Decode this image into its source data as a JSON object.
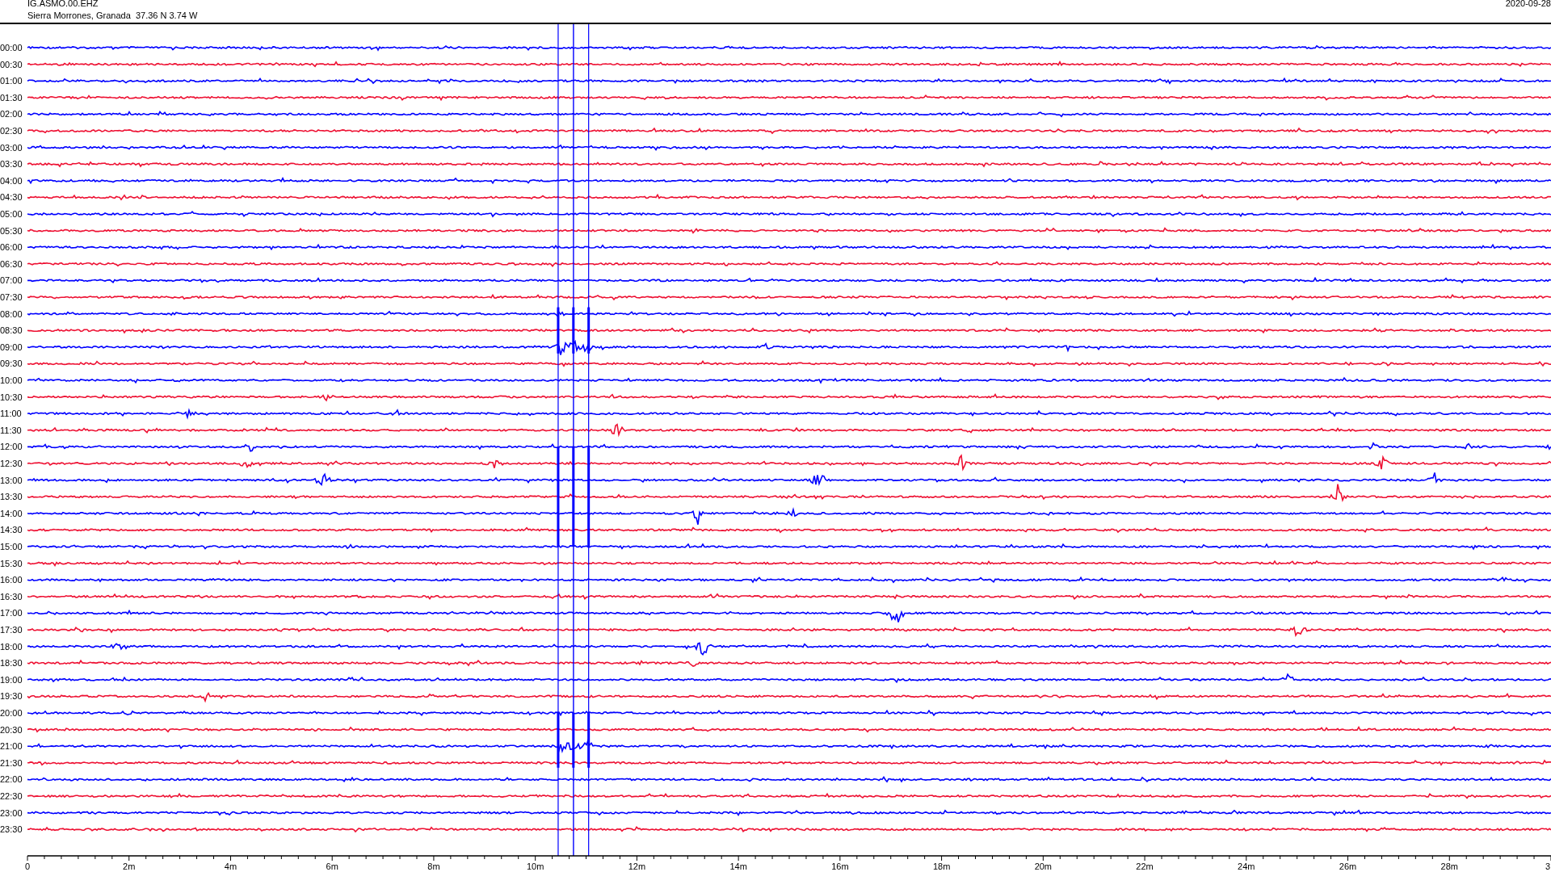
{
  "header": {
    "station": "IG.ASMO.00.EHZ",
    "location": "Sierra Morrones, Granada  37.36 N 3.74 W",
    "date": "2020-09-28"
  },
  "rows": [
    {
      "time": "00:00",
      "color": "#0000ff"
    },
    {
      "time": "00:30",
      "color": "#ee1133"
    },
    {
      "time": "01:00",
      "color": "#0000ff"
    },
    {
      "time": "01:30",
      "color": "#ee1133"
    },
    {
      "time": "02:00",
      "color": "#0000ff"
    },
    {
      "time": "02:30",
      "color": "#ee1133"
    },
    {
      "time": "03:00",
      "color": "#0000ff"
    },
    {
      "time": "03:30",
      "color": "#ee1133"
    },
    {
      "time": "04:00",
      "color": "#0000ff"
    },
    {
      "time": "04:30",
      "color": "#ee1133"
    },
    {
      "time": "05:00",
      "color": "#0000ff"
    },
    {
      "time": "05:30",
      "color": "#ee1133"
    },
    {
      "time": "06:00",
      "color": "#0000ff"
    },
    {
      "time": "06:30",
      "color": "#ee1133"
    },
    {
      "time": "07:00",
      "color": "#0000ff"
    },
    {
      "time": "07:30",
      "color": "#ee1133"
    },
    {
      "time": "08:00",
      "color": "#0000ff"
    },
    {
      "time": "08:30",
      "color": "#ee1133"
    },
    {
      "time": "09:00",
      "color": "#0000ff"
    },
    {
      "time": "09:30",
      "color": "#ee1133"
    },
    {
      "time": "10:00",
      "color": "#0000ff"
    },
    {
      "time": "10:30",
      "color": "#ee1133"
    },
    {
      "time": "11:00",
      "color": "#0000ff"
    },
    {
      "time": "11:30",
      "color": "#ee1133"
    },
    {
      "time": "12:00",
      "color": "#0000ff"
    },
    {
      "time": "12:30",
      "color": "#ee1133"
    },
    {
      "time": "13:00",
      "color": "#0000ff"
    },
    {
      "time": "13:30",
      "color": "#ee1133"
    },
    {
      "time": "14:00",
      "color": "#0000ff"
    },
    {
      "time": "14:30",
      "color": "#ee1133"
    },
    {
      "time": "15:00",
      "color": "#0000ff"
    },
    {
      "time": "15:30",
      "color": "#ee1133"
    },
    {
      "time": "16:00",
      "color": "#0000ff"
    },
    {
      "time": "16:30",
      "color": "#ee1133"
    },
    {
      "time": "17:00",
      "color": "#0000ff"
    },
    {
      "time": "17:30",
      "color": "#ee1133"
    },
    {
      "time": "18:00",
      "color": "#0000ff"
    },
    {
      "time": "18:30",
      "color": "#ee1133"
    },
    {
      "time": "19:00",
      "color": "#0000ff"
    },
    {
      "time": "19:30",
      "color": "#ee1133"
    },
    {
      "time": "20:00",
      "color": "#0000ff"
    },
    {
      "time": "20:30",
      "color": "#ee1133"
    },
    {
      "time": "21:00",
      "color": "#0000ff"
    },
    {
      "time": "21:30",
      "color": "#ee1133"
    },
    {
      "time": "22:00",
      "color": "#0000ff"
    },
    {
      "time": "22:30",
      "color": "#ee1133"
    },
    {
      "time": "23:00",
      "color": "#0000ff"
    },
    {
      "time": "23:30",
      "color": "#ee1133"
    }
  ],
  "x_axis": {
    "labels": [
      "0",
      "2m",
      "4m",
      "6m",
      "8m",
      "10m",
      "12m",
      "14m",
      "16m",
      "18m",
      "20m",
      "22m",
      "24m",
      "26m",
      "28m",
      "3"
    ]
  }
}
